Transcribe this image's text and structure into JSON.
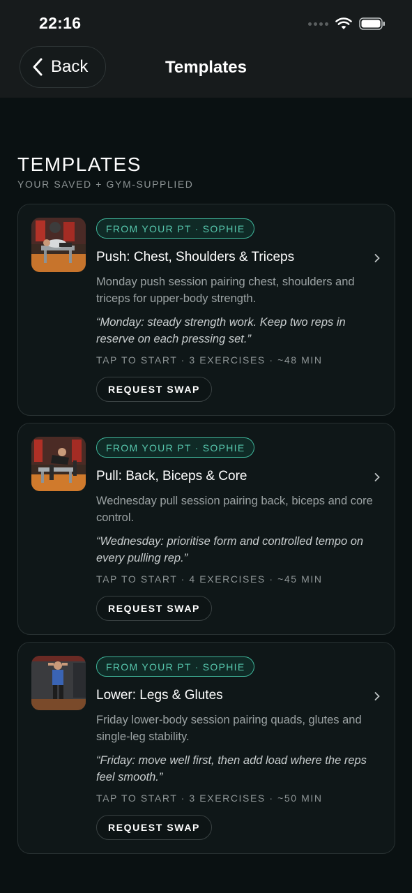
{
  "status_bar": {
    "time": "22:16"
  },
  "nav": {
    "back_label": "Back",
    "title": "Templates"
  },
  "section": {
    "heading": "TEMPLATES",
    "subheading": "YOUR SAVED + GYM-SUPPLIED"
  },
  "colors": {
    "accent": "#57c7ad",
    "background": "#0a1112",
    "card": "#0f1718"
  },
  "templates": [
    {
      "badge": "FROM YOUR PT · SOPHIE",
      "title": "Push: Chest, Shoulders & Triceps",
      "description": "Monday push session pairing chest, shoulders and triceps for upper-body strength.",
      "note": "“Monday: steady strength work. Keep two reps in reserve on each pressing set.”",
      "meta": "TAP TO START · 3 EXERCISES · ~48 MIN",
      "button": "REQUEST SWAP",
      "thumbnail_icon": "bench-press-photo"
    },
    {
      "badge": "FROM YOUR PT · SOPHIE",
      "title": "Pull: Back, Biceps & Core",
      "description": "Wednesday pull session pairing back, biceps and core control.",
      "note": "“Wednesday: prioritise form and controlled tempo on every pulling rep.”",
      "meta": "TAP TO START · 4 EXERCISES · ~45 MIN",
      "button": "REQUEST SWAP",
      "thumbnail_icon": "dumbbell-row-photo"
    },
    {
      "badge": "FROM YOUR PT · SOPHIE",
      "title": "Lower: Legs & Glutes",
      "description": "Friday lower-body session pairing quads, glutes and single-leg stability.",
      "note": "“Friday: move well first, then add load where the reps feel smooth.”",
      "meta": "TAP TO START · 3 EXERCISES · ~50 MIN",
      "button": "REQUEST SWAP",
      "thumbnail_icon": "squat-photo"
    }
  ]
}
